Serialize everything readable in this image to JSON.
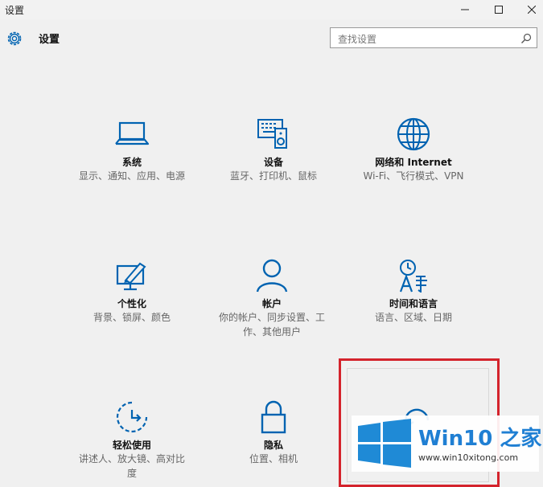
{
  "window": {
    "title": "设置",
    "minimize_glyph": "—",
    "maximize_glyph": "☐",
    "close_glyph": "✕"
  },
  "header": {
    "title": "设置",
    "icon": "gear-icon"
  },
  "search": {
    "placeholder": "查找设置",
    "icon": "search-icon"
  },
  "accent_color": "#0063b1",
  "tiles": [
    {
      "name": "系统",
      "desc": "显示、通知、应用、电源",
      "icon": "laptop-icon"
    },
    {
      "name": "设备",
      "desc": "蓝牙、打印机、鼠标",
      "icon": "devices-icon"
    },
    {
      "name": "网络和 Internet",
      "desc": "Wi-Fi、飞行模式、VPN",
      "icon": "globe-icon"
    },
    {
      "name": "个性化",
      "desc": "背景、锁屏、颜色",
      "icon": "personalize-icon"
    },
    {
      "name": "帐户",
      "desc": "你的帐户、同步设置、工作、其他用户",
      "icon": "person-icon"
    },
    {
      "name": "时间和语言",
      "desc": "语言、区域、日期",
      "icon": "time-language-icon"
    },
    {
      "name": "轻松使用",
      "desc": "讲述人、放大镜、高对比度",
      "icon": "ease-of-access-icon"
    },
    {
      "name": "隐私",
      "desc": "位置、相机",
      "icon": "lock-icon"
    }
  ],
  "watermark": {
    "brand": "Win10 之家",
    "url": "www.win10xitong.com",
    "highlight_color": "#d4232c"
  }
}
